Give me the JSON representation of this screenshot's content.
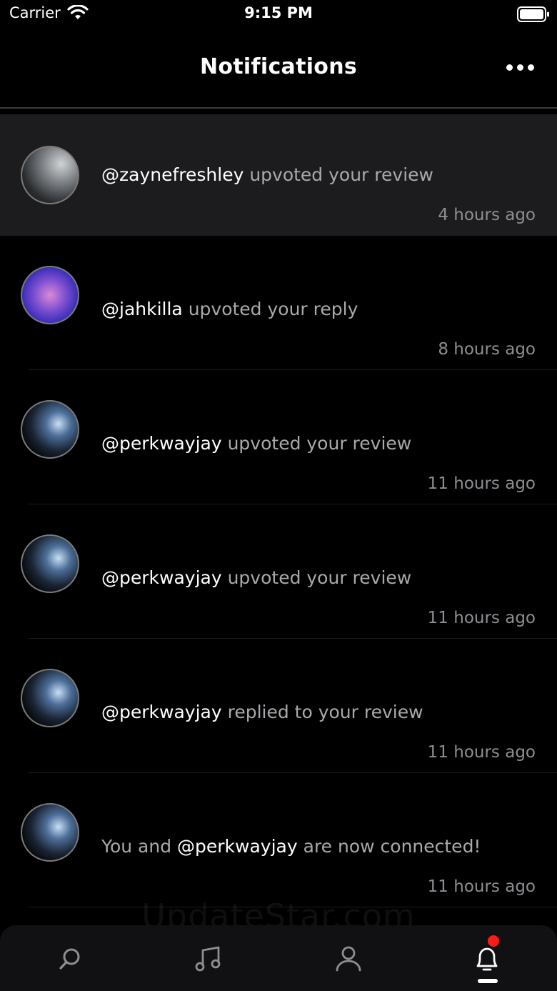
{
  "status_bar": {
    "carrier": "Carrier",
    "time": "9:15 PM"
  },
  "header": {
    "title": "Notifications"
  },
  "notifications": [
    {
      "handle_before": "",
      "handle": "@zaynefreshley",
      "action": " upvoted your review",
      "time": "4 hours ago",
      "highlighted": true
    },
    {
      "handle_before": "",
      "handle": "@jahkilla",
      "action": " upvoted your reply",
      "time": "8 hours ago",
      "highlighted": false
    },
    {
      "handle_before": "",
      "handle": "@perkwayjay",
      "action": " upvoted your review",
      "time": "11 hours ago",
      "highlighted": false
    },
    {
      "handle_before": "",
      "handle": "@perkwayjay",
      "action": " upvoted your review",
      "time": "11 hours ago",
      "highlighted": false
    },
    {
      "handle_before": "",
      "handle": "@perkwayjay",
      "action": " replied to your review",
      "time": "11 hours ago",
      "highlighted": false
    },
    {
      "handle_before": "You and ",
      "handle": "@perkwayjay",
      "action": " are now connected!",
      "time": "11 hours ago",
      "highlighted": false
    }
  ],
  "watermark": "UpdateStar.com",
  "tab_bar": {
    "tabs": [
      {
        "name": "search",
        "icon": "search-icon"
      },
      {
        "name": "music",
        "icon": "music-note-icon"
      },
      {
        "name": "profile",
        "icon": "person-icon"
      },
      {
        "name": "notifications",
        "icon": "bell-icon",
        "active": true,
        "has_badge": true
      }
    ]
  },
  "colors": {
    "background": "#000000",
    "highlight_row": "#1c1c1e",
    "secondary_text": "#a9a9ad",
    "badge": "#ff1a1a"
  }
}
